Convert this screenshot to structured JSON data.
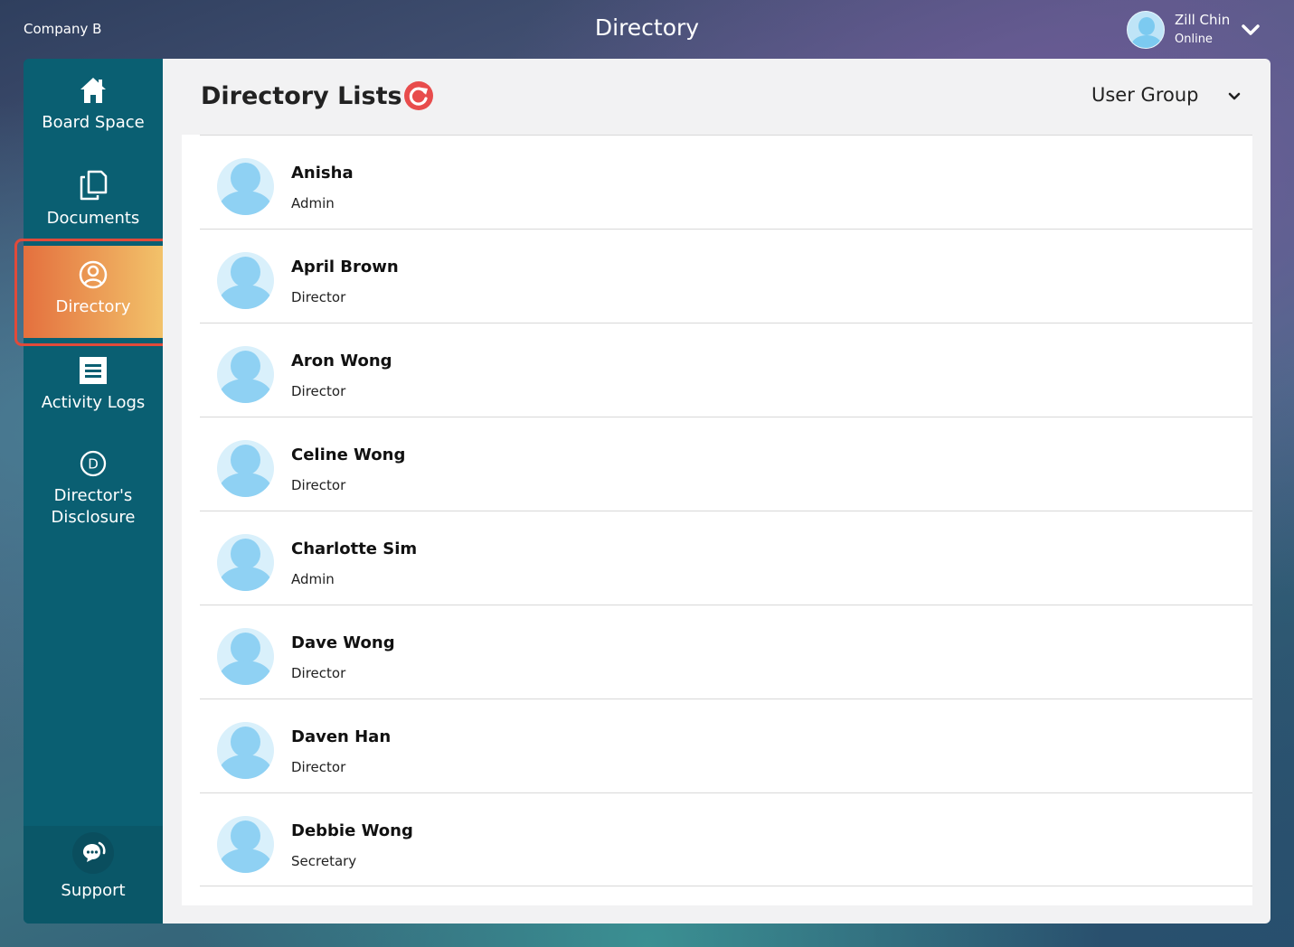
{
  "header": {
    "company": "Company B",
    "title": "Directory",
    "user": {
      "name": "Zill Chin",
      "status": "Online"
    }
  },
  "sidebar": {
    "items": [
      {
        "label": "Board Space",
        "icon": "home-icon"
      },
      {
        "label": "Documents",
        "icon": "documents-icon"
      },
      {
        "label": "Directory",
        "icon": "user-circle-icon",
        "active": true
      },
      {
        "label": "Activity Logs",
        "icon": "list-icon"
      },
      {
        "label": "Director's",
        "label2": "Disclosure",
        "icon": "letter-d-circle-icon"
      }
    ],
    "support": {
      "label": "Support",
      "icon": "chat-bubble-icon"
    }
  },
  "main": {
    "title": "Directory Lists",
    "filter": {
      "selected": "User Group"
    },
    "colors": {
      "accent": "#e84c4c",
      "sidebar": "#0a5f72",
      "active_from": "#e4703e",
      "active_to": "#f2c26a"
    }
  },
  "people": [
    {
      "name": "Anisha",
      "role": "Admin"
    },
    {
      "name": "April Brown",
      "role": "Director"
    },
    {
      "name": "Aron Wong",
      "role": "Director"
    },
    {
      "name": "Celine Wong",
      "role": "Director"
    },
    {
      "name": "Charlotte Sim",
      "role": "Admin"
    },
    {
      "name": "Dave Wong",
      "role": "Director"
    },
    {
      "name": "Daven Han",
      "role": "Director"
    },
    {
      "name": "Debbie Wong",
      "role": "Secretary"
    }
  ]
}
